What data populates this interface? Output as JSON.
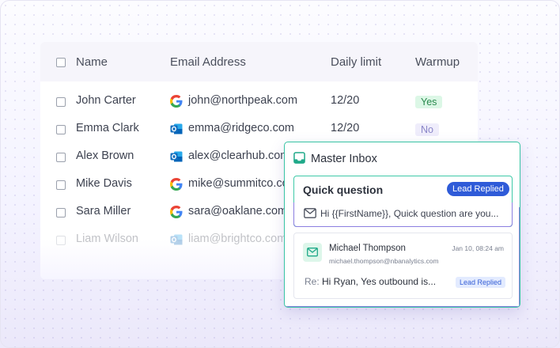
{
  "table": {
    "headers": {
      "name": "Name",
      "email": "Email Address",
      "limit": "Daily limit",
      "warmup": "Warmup"
    },
    "rows": [
      {
        "name": "John Carter",
        "provider": "google",
        "email": "john@northpeak.com",
        "limit": "12/20",
        "warmup": "Yes"
      },
      {
        "name": "Emma Clark",
        "provider": "outlook",
        "email": "emma@ridgeco.com",
        "limit": "12/20",
        "warmup": "No"
      },
      {
        "name": "Alex Brown",
        "provider": "outlook",
        "email": "alex@clearhub.com",
        "limit": "",
        "warmup": ""
      },
      {
        "name": "Mike Davis",
        "provider": "google",
        "email": "mike@summitco.com",
        "limit": "",
        "warmup": ""
      },
      {
        "name": "Sara Miller",
        "provider": "google",
        "email": "sara@oaklane.com",
        "limit": "",
        "warmup": ""
      },
      {
        "name": "Liam Wilson",
        "provider": "outlook",
        "email": "liam@brightco.com",
        "limit": "",
        "warmup": ""
      }
    ]
  },
  "inbox": {
    "title": "Master Inbox",
    "message1": {
      "subject": "Quick question",
      "badge": "Lead Replied",
      "preview": "Hi {{FirstName}}, Quick question are you..."
    },
    "message2": {
      "sender_name": "Michael Thompson",
      "sender_email": "michael.thompson@nbanalytics.com",
      "time": "Jan 10, 08:24 am",
      "re_label": "Re:",
      "preview": "Hi Ryan, Yes outbound is...",
      "badge": "Lead Replied"
    }
  },
  "colors": {
    "accent_teal": "#38c4a4",
    "accent_purple": "#8b7fe0",
    "badge_blue": "#2f5bd8",
    "yes_bg": "#dcf7e6",
    "no_bg": "#efedfb"
  }
}
